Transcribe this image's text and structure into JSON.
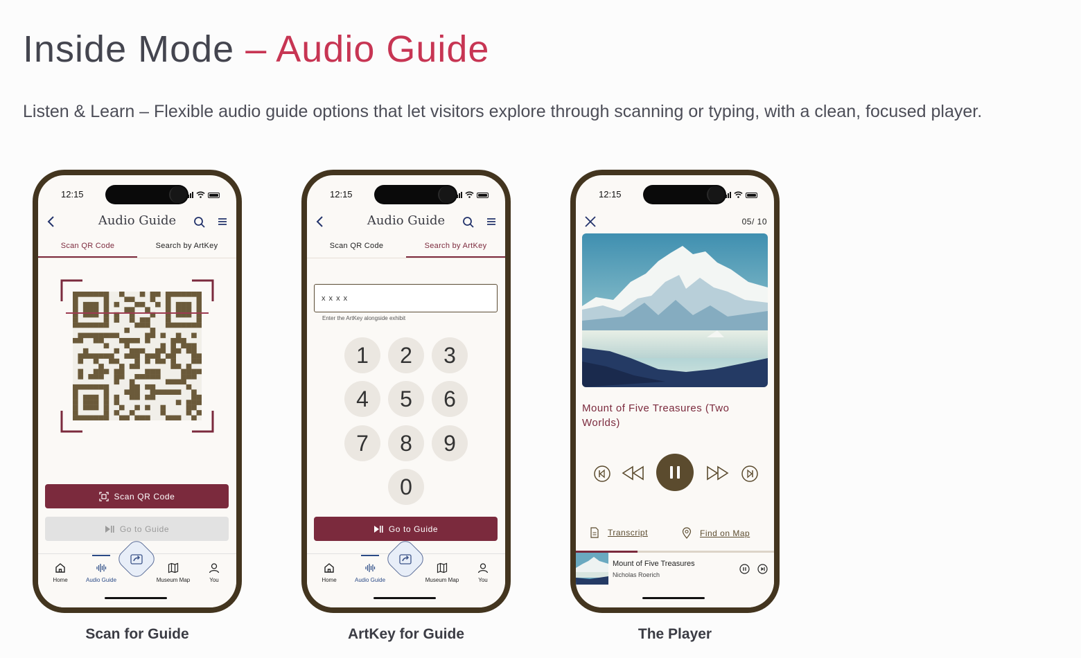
{
  "header": {
    "title_main": "Inside Mode ",
    "title_accent": "– Audio Guide",
    "subtitle": "Listen & Learn – Flexible audio guide options that let visitors explore through scanning or typing, with a clean, focused player."
  },
  "status_time": "12:15",
  "screen_title": "Audio Guide",
  "tabs": {
    "scan": "Scan QR Code",
    "search": "Search by ArtKey"
  },
  "tabbar": {
    "home": "Home",
    "audio": "Audio Guide",
    "map": "Museum Map",
    "you": "You"
  },
  "phone1": {
    "caption": "Scan for Guide",
    "scan_button": "Scan QR Code",
    "go_button": "Go to Guide"
  },
  "phone2": {
    "caption": "ArtKey for Guide",
    "input_value": "x x x x",
    "input_hint": "Enter the ArtKey alongside exhibit",
    "keys": [
      "1",
      "2",
      "3",
      "4",
      "5",
      "6",
      "7",
      "8",
      "9",
      "0"
    ],
    "go_button": "Go to Guide"
  },
  "phone3": {
    "caption": "The Player",
    "counter": "05/ 10",
    "artwork_title": "Mount of Five Treasures (Two Worlds)",
    "transcript": "Transcript",
    "find_on_map": "Find on Map",
    "mini_title": "Mount of Five Treasures",
    "mini_artist": "Nicholas Roerich",
    "progress": 0.31
  },
  "colors": {
    "accent": "#c73553",
    "primary": "#7b2a3d",
    "frame": "#43351f",
    "qr": "#6b5a3a"
  }
}
